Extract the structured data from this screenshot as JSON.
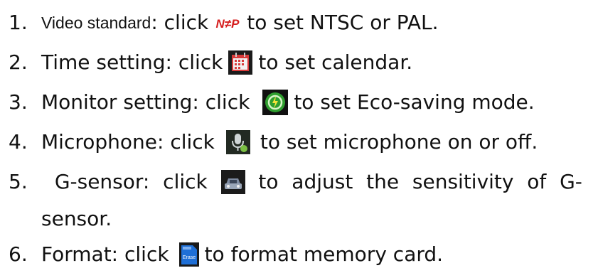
{
  "items": [
    {
      "number": "1.",
      "before_label": "Video standard",
      "before_rest": ": click",
      "icon_text": "N≠P",
      "after": "to set NTSC or PAL."
    },
    {
      "number": "2.",
      "before": "Time setting: click",
      "after": "to set calendar."
    },
    {
      "number": "3.",
      "before": "Monitor setting: click",
      "after": "to set Eco-saving mode."
    },
    {
      "number": "4.",
      "before": "Microphone: click",
      "after": "to set microphone on or off."
    },
    {
      "number": "5.",
      "words": [
        "G-sensor:",
        "click",
        "to",
        "adjust",
        "the",
        "sensitivity",
        "of",
        "G-"
      ],
      "continuation": "sensor."
    },
    {
      "number": "6.",
      "before": "Format: click",
      "icon_text": "Erase",
      "after": "to format memory card."
    }
  ]
}
